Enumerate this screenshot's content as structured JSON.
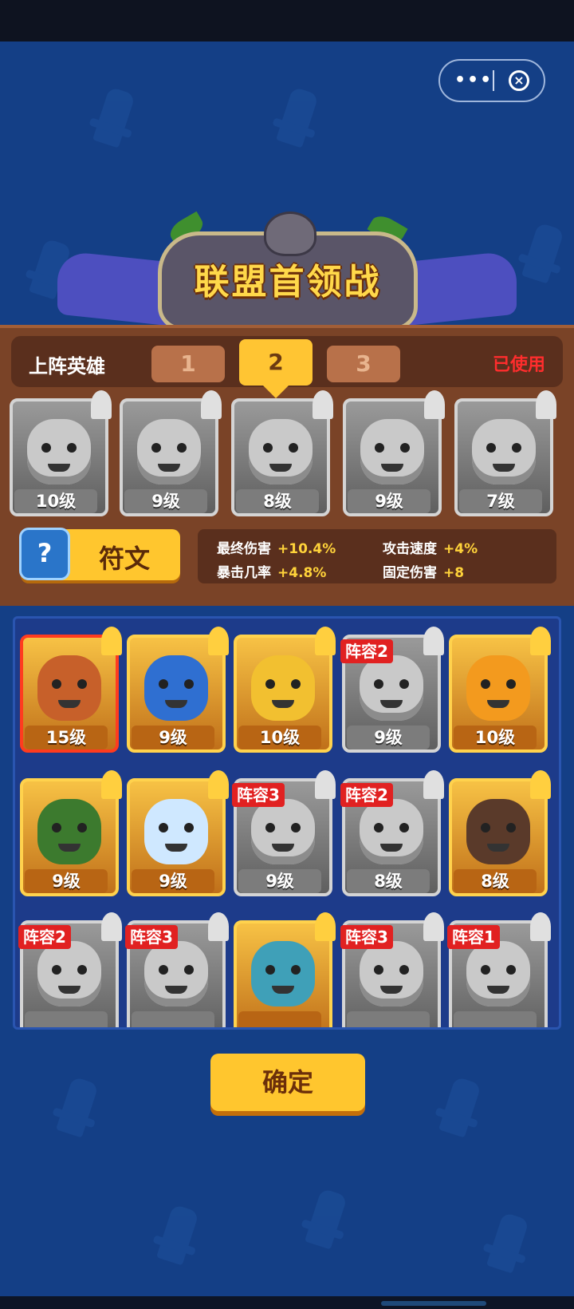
{
  "capsule": {
    "menu_icon": "more-dots-icon",
    "close_icon": "close-circle-icon"
  },
  "banner": {
    "title": "联盟首领战"
  },
  "lineup": {
    "label": "上阵英雄",
    "tabs": [
      {
        "label": "1"
      },
      {
        "label": "2"
      },
      {
        "label": "3"
      }
    ],
    "active_tab": "2",
    "status": "已使用",
    "heroes": [
      {
        "level": "10级"
      },
      {
        "level": "9级"
      },
      {
        "level": "8级"
      },
      {
        "level": "9级"
      },
      {
        "level": "7级"
      }
    ]
  },
  "rune": {
    "button_label": "符文",
    "icon_glyph": "?",
    "stats": [
      {
        "name": "最终伤害",
        "value": "+10.4%"
      },
      {
        "name": "攻击速度",
        "value": "+4%"
      },
      {
        "name": "暴击几率",
        "value": "+4.8%"
      },
      {
        "name": "固定伤害",
        "value": "+8"
      }
    ]
  },
  "pool": {
    "heroes": [
      {
        "level": "15级",
        "badge": "",
        "colors": "#c7602a"
      },
      {
        "level": "9级",
        "badge": "",
        "colors": "#2f6fd1"
      },
      {
        "level": "10级",
        "badge": "",
        "colors": "#f2c030"
      },
      {
        "level": "9级",
        "badge": "阵容2",
        "colors": ""
      },
      {
        "level": "10级",
        "badge": "",
        "colors": "#f39a1e"
      },
      {
        "level": "9级",
        "badge": "",
        "colors": "#3c7a2e"
      },
      {
        "level": "9级",
        "badge": "",
        "colors": "#cfe8ff"
      },
      {
        "level": "9级",
        "badge": "阵容3",
        "colors": ""
      },
      {
        "level": "8级",
        "badge": "阵容2",
        "colors": ""
      },
      {
        "level": "8级",
        "badge": "",
        "colors": "#5a3a2a"
      },
      {
        "level": "",
        "badge": "阵容2",
        "colors": ""
      },
      {
        "level": "",
        "badge": "阵容3",
        "colors": ""
      },
      {
        "level": "",
        "badge": "",
        "colors": "#3fa0b8"
      },
      {
        "level": "",
        "badge": "阵容3",
        "colors": ""
      },
      {
        "level": "",
        "badge": "阵容1",
        "colors": ""
      }
    ]
  },
  "confirm_label": "确定"
}
